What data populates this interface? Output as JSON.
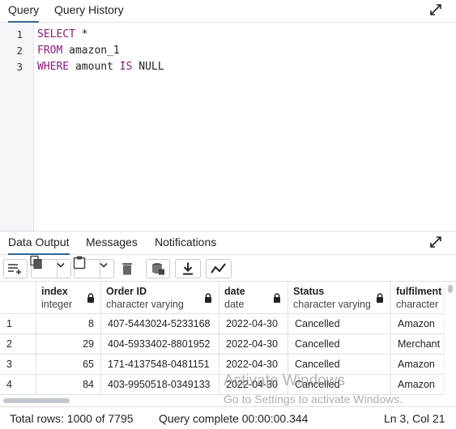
{
  "query_tabs": [
    {
      "label": "Query",
      "active": true
    },
    {
      "label": "Query History",
      "active": false
    }
  ],
  "editor": {
    "line_numbers": [
      "1",
      "2",
      "3"
    ],
    "lines": [
      [
        {
          "t": "SELECT",
          "kw": true
        },
        {
          "t": " *",
          "kw": false
        }
      ],
      [
        {
          "t": "FROM",
          "kw": true
        },
        {
          "t": " amazon_1",
          "kw": false
        }
      ],
      [
        {
          "t": "WHERE",
          "kw": true
        },
        {
          "t": " amount ",
          "kw": false
        },
        {
          "t": "IS",
          "kw": true
        },
        {
          "t": " NULL",
          "kw": false
        }
      ]
    ],
    "keyword_color": "#8a1a7a"
  },
  "output_tabs": [
    {
      "label": "Data Output",
      "active": true
    },
    {
      "label": "Messages",
      "active": false
    },
    {
      "label": "Notifications",
      "active": false
    }
  ],
  "toolbar": {
    "buttons": [
      "add-row-icon",
      "copy-icon",
      "chevron-down-icon",
      "paste-icon",
      "chevron-down-icon",
      "delete-icon",
      "save-data-icon",
      "download-icon",
      "graph-icon"
    ]
  },
  "grid": {
    "columns": [
      {
        "name": "index",
        "type": "integer"
      },
      {
        "name": "Order ID",
        "type": "character varying"
      },
      {
        "name": "date",
        "type": "date"
      },
      {
        "name": "Status",
        "type": "character varying"
      },
      {
        "name": "fulfilment",
        "type": "character"
      }
    ],
    "rows": [
      {
        "num": "1",
        "cells": [
          "8",
          "407-5443024-5233168",
          "2022-04-30",
          "Cancelled",
          "Amazon"
        ]
      },
      {
        "num": "2",
        "cells": [
          "29",
          "404-5933402-8801952",
          "2022-04-30",
          "Cancelled",
          "Merchant"
        ]
      },
      {
        "num": "3",
        "cells": [
          "65",
          "171-4137548-0481151",
          "2022-04-30",
          "Cancelled",
          "Amazon"
        ]
      },
      {
        "num": "4",
        "cells": [
          "84",
          "403-9950518-0349133",
          "2022-04-30",
          "Cancelled",
          "Amazon"
        ]
      }
    ]
  },
  "watermark": {
    "line1": "Activate Windows",
    "line2": "Go to Settings to activate Windows."
  },
  "status": {
    "total_rows": "Total rows: 1000 of 7795",
    "query_complete": "Query complete 00:00:00.344",
    "cursor": "Ln 3, Col 21"
  },
  "accent_color": "#326690"
}
